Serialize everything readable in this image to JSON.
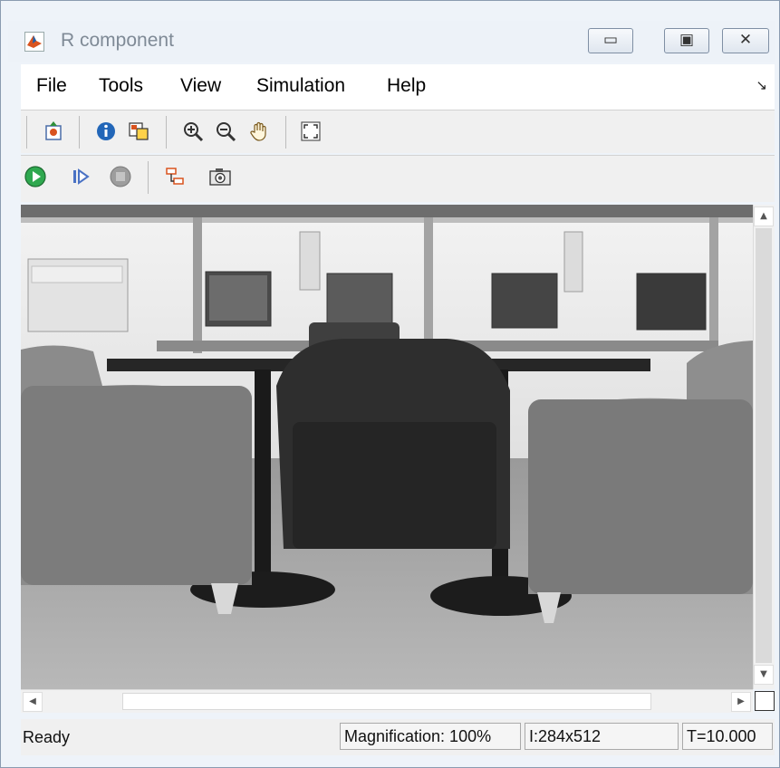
{
  "window": {
    "title": "R component",
    "icon": "matlab-icon",
    "controls": {
      "minimize": "▭",
      "maximize": "▣",
      "close": "✕"
    }
  },
  "menubar": {
    "items": [
      {
        "label": "File"
      },
      {
        "label": "Tools"
      },
      {
        "label": "View"
      },
      {
        "label": "Simulation"
      },
      {
        "label": "Help"
      }
    ],
    "dock_arrow": "↘"
  },
  "toolbar1": {
    "icons": [
      "print-to-figure-icon",
      "info-icon",
      "maintain-fit-icon",
      "zoom-in-icon",
      "zoom-out-icon",
      "pan-hand-icon",
      "fit-to-window-icon"
    ]
  },
  "toolbar2": {
    "icons": [
      "run-icon",
      "step-forward-icon",
      "stop-icon",
      "highlight-block-icon",
      "snapshot-camera-icon"
    ],
    "run_color": "#2fa84f",
    "stop_color": "#9d9d9d"
  },
  "viewport": {
    "image_description_icon": "grayscale-office-photo"
  },
  "statusbar": {
    "state": "Ready",
    "magnification": "Magnification: 100%",
    "image_size": "I:284x512",
    "time": "T=10.000"
  }
}
